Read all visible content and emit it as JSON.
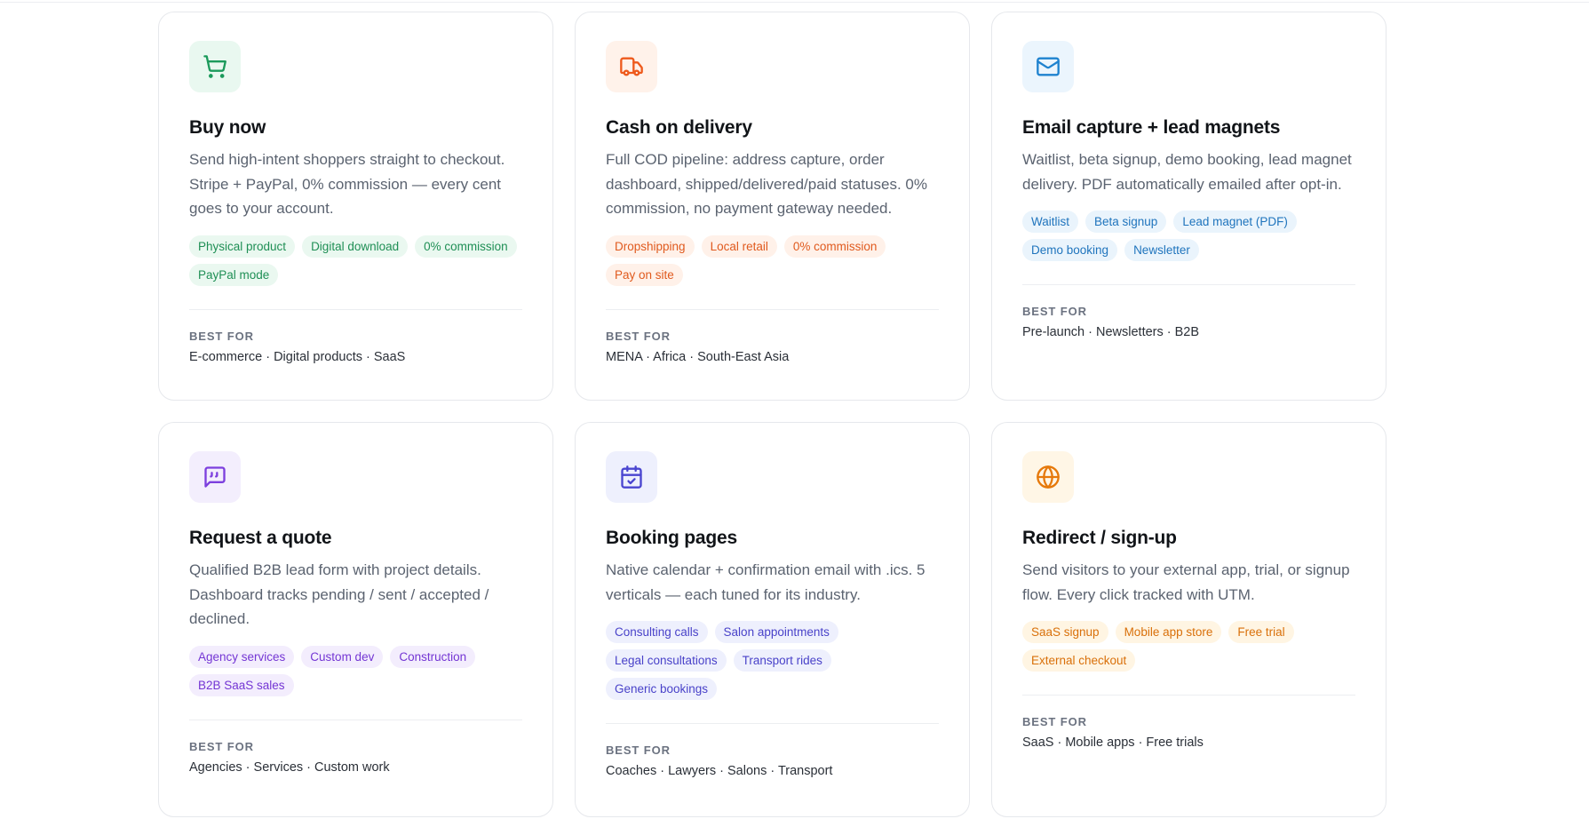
{
  "cards": [
    {
      "icon": "cart-icon",
      "accent": "#1b9a5b",
      "title": "Buy now",
      "description": "Send high-intent shoppers straight to checkout. Stripe + PayPal, 0% commission — every cent goes to your account.",
      "tags": [
        "Physical product",
        "Digital download",
        "0% commission",
        "PayPal mode"
      ],
      "best_for_label": "BEST FOR",
      "best_for": "E-commerce · Digital products · SaaS"
    },
    {
      "icon": "truck-icon",
      "accent": "#ee5a1c",
      "title": "Cash on delivery",
      "description": "Full COD pipeline: address capture, order dashboard, shipped/delivered/paid statuses. 0% commission, no payment gateway needed.",
      "tags": [
        "Dropshipping",
        "Local retail",
        "0% commission",
        "Pay on site"
      ],
      "best_for_label": "BEST FOR",
      "best_for": "MENA · Africa · South-East Asia"
    },
    {
      "icon": "mail-icon",
      "accent": "#1e82cf",
      "title": "Email capture + lead magnets",
      "description": "Waitlist, beta signup, demo booking, lead magnet delivery. PDF automatically emailed after opt-in.",
      "tags": [
        "Waitlist",
        "Beta signup",
        "Lead magnet (PDF)",
        "Demo booking",
        "Newsletter"
      ],
      "best_for_label": "BEST FOR",
      "best_for": "Pre-launch · Newsletters · B2B"
    },
    {
      "icon": "quote-message-icon",
      "accent": "#7c3fde",
      "title": "Request a quote",
      "description": "Qualified B2B lead form with project details. Dashboard tracks pending / sent / accepted / declined.",
      "tags": [
        "Agency services",
        "Custom dev",
        "Construction",
        "B2B SaaS sales"
      ],
      "best_for_label": "BEST FOR",
      "best_for": "Agencies · Services · Custom work"
    },
    {
      "icon": "calendar-check-icon",
      "accent": "#4a45d0",
      "title": "Booking pages",
      "description": "Native calendar + confirmation email with .ics. 5 verticals — each tuned for its industry.",
      "tags": [
        "Consulting calls",
        "Salon appointments",
        "Legal consultations",
        "Transport rides",
        "Generic bookings"
      ],
      "best_for_label": "BEST FOR",
      "best_for": "Coaches · Lawyers · Salons · Transport"
    },
    {
      "icon": "globe-icon",
      "accent": "#e6790b",
      "title": "Redirect / sign-up",
      "description": "Send visitors to your external app, trial, or signup flow. Every click tracked with UTM.",
      "tags": [
        "SaaS signup",
        "Mobile app store",
        "Free trial",
        "External checkout"
      ],
      "best_for_label": "BEST FOR",
      "best_for": "SaaS · Mobile apps · Free trials"
    }
  ]
}
